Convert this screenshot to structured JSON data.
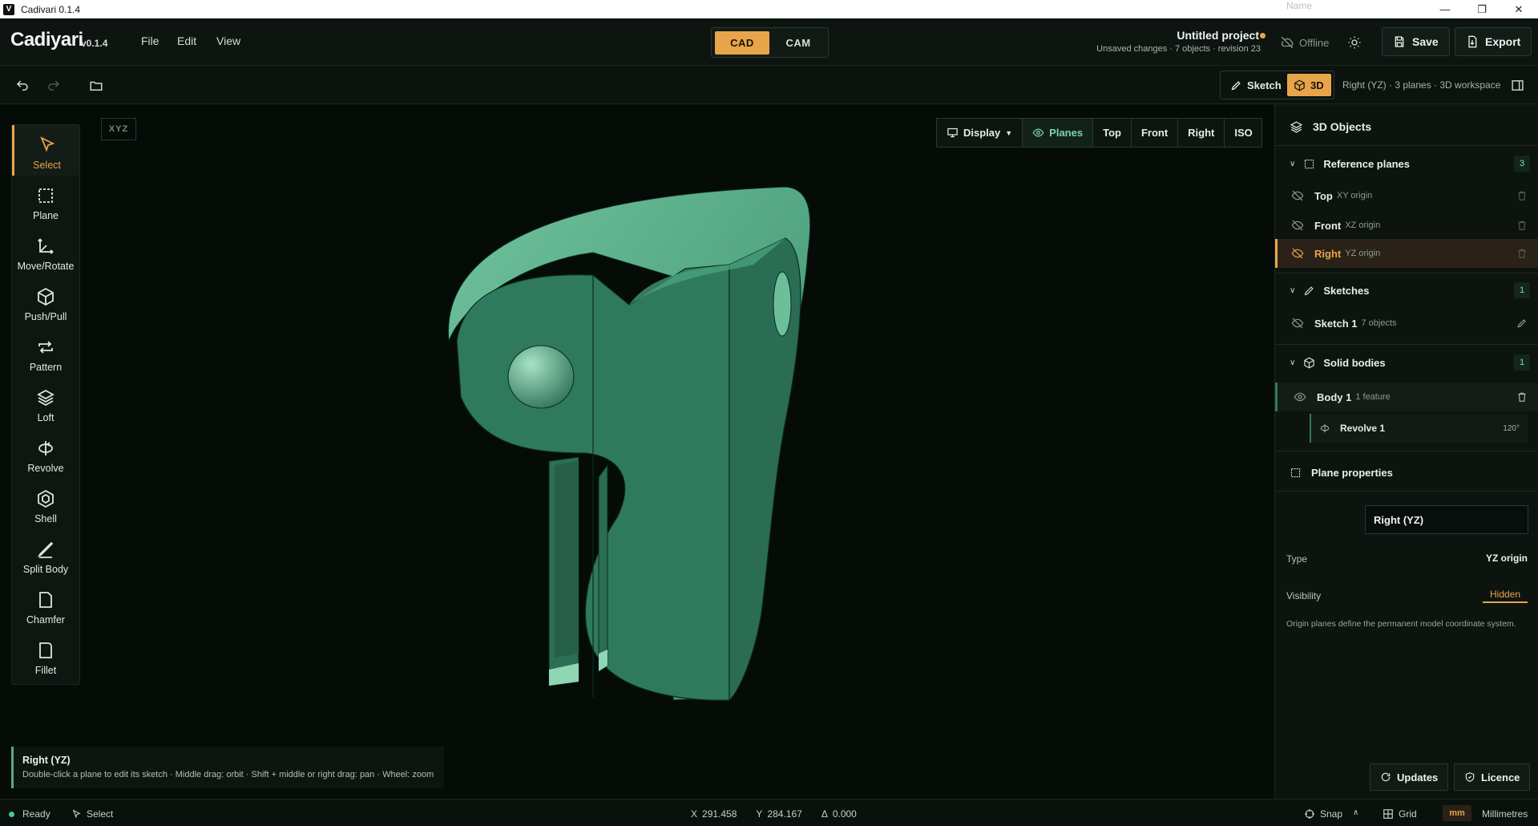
{
  "os_window": {
    "app_letter": "V",
    "title": "Cadivari 0.1.4",
    "controls": [
      "minimize",
      "restore",
      "close"
    ]
  },
  "header": {
    "logo": "Cadiyari",
    "version": "v0.1.4",
    "menus": [
      "File",
      "Edit",
      "View"
    ],
    "modes": [
      "CAD",
      "CAM"
    ],
    "active_mode": "CAD",
    "project_title": "Untitled project",
    "project_status": "Unsaved changes · 7 objects · revision 23",
    "offline_label": "Offline",
    "save_label": "Save",
    "export_label": "Export"
  },
  "toolbar": {
    "view_modes": [
      "Sketch",
      "3D"
    ],
    "active_view_mode": "3D",
    "workspace_info": "Right (YZ) · 3 planes · 3D workspace"
  },
  "tools": [
    {
      "label": "Select",
      "icon": "cursor-arrow-icon",
      "active": true
    },
    {
      "label": "Plane",
      "icon": "plane-dashed-square-icon",
      "active": false
    },
    {
      "label": "Move/Rotate",
      "icon": "move-axes-icon",
      "active": false
    },
    {
      "label": "Push/Pull",
      "icon": "cube-icon",
      "active": false
    },
    {
      "label": "Pattern",
      "icon": "repeat-arrows-icon",
      "active": false
    },
    {
      "label": "Loft",
      "icon": "layers-icon",
      "active": false
    },
    {
      "label": "Revolve",
      "icon": "revolve-icon",
      "active": false
    },
    {
      "label": "Shell",
      "icon": "shell-cube-icon",
      "active": false
    },
    {
      "label": "Split Body",
      "icon": "knife-icon",
      "active": false
    },
    {
      "label": "Chamfer",
      "icon": "chamfer-page-icon",
      "active": false
    },
    {
      "label": "Fillet",
      "icon": "fillet-page-icon",
      "active": false
    }
  ],
  "viewport": {
    "axis_badge": "XYZ",
    "display_label": "Display",
    "planes_label": "Planes",
    "view_buttons": [
      "Top",
      "Front",
      "Right",
      "ISO"
    ],
    "hint_title": "Right (YZ)",
    "hint_text": "Double-click a plane to edit its sketch · Middle drag: orbit · Shift + middle or right drag: pan · Wheel: zoom",
    "model_color": "#2f7a5e"
  },
  "objects_panel": {
    "title": "3D Objects",
    "reference_planes": {
      "title": "Reference planes",
      "count": "3",
      "items": [
        {
          "name": "Top",
          "sub": "XY origin",
          "selected": false
        },
        {
          "name": "Front",
          "sub": "XZ origin",
          "selected": false
        },
        {
          "name": "Right",
          "sub": "YZ origin",
          "selected": true
        }
      ]
    },
    "sketches": {
      "title": "Sketches",
      "count": "1",
      "items": [
        {
          "name": "Sketch 1",
          "sub": "7 objects"
        }
      ]
    },
    "solid_bodies": {
      "title": "Solid bodies",
      "count": "1",
      "items": [
        {
          "name": "Body 1",
          "sub": "1 feature"
        }
      ],
      "feature": {
        "name": "Revolve 1",
        "value": "120°"
      }
    }
  },
  "plane_properties": {
    "title": "Plane properties",
    "name_label": "Name",
    "name_value": "Right (YZ)",
    "type_label": "Type",
    "type_value": "YZ origin",
    "visibility_label": "Visibility",
    "visibility_value": "Hidden",
    "note": "Origin planes define the permanent model coordinate system."
  },
  "panel_footer": {
    "updates_label": "Updates",
    "licence_label": "Licence"
  },
  "statusbar": {
    "status": "Ready",
    "tool": "Select",
    "x_label": "X",
    "x_value": "291.458",
    "y_label": "Y",
    "y_value": "284.167",
    "delta_label": "Δ",
    "delta_value": "0.000",
    "snap_label": "Snap",
    "grid_label": "Grid",
    "unit_short": "mm",
    "unit_long": "Millimetres"
  },
  "colors": {
    "accent": "#e8a44a",
    "selection_green": "#7fd1b2",
    "background": "#050c08",
    "status_ready": "#3ccf8e"
  }
}
